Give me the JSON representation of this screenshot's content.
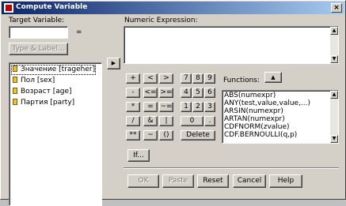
{
  "window": {
    "title": "Compute Variable",
    "close_glyph": "×"
  },
  "target": {
    "label": "Target Variable:",
    "value": "",
    "equals": "="
  },
  "type_label_button": "Type & Label...",
  "numeric_expression": {
    "label": "Numeric Expression:",
    "value": ""
  },
  "variables": [
    {
      "label": "Значение [trageher]",
      "selected": true
    },
    {
      "label": "Пол [sex]"
    },
    {
      "label": "Возраст [age]"
    },
    {
      "label": "Партия [party]"
    }
  ],
  "move_arrow": "▶",
  "keypad": [
    [
      "+",
      "<",
      ">",
      "7",
      "8",
      "9"
    ],
    [
      "-",
      "<=",
      ">=",
      "4",
      "5",
      "6"
    ],
    [
      "*",
      "=",
      "~=",
      "1",
      "2",
      "3"
    ],
    [
      "/",
      "&",
      "|",
      "0",
      "."
    ],
    [
      "**",
      "~",
      "()",
      "Delete"
    ]
  ],
  "functions": {
    "label": "Functions:",
    "up_arrow": "▲",
    "items": [
      "ABS(numexpr)",
      "ANY(test,value,value,...)",
      "ARSIN(numexpr)",
      "ARTAN(numexpr)",
      "CDFNORM(zvalue)",
      "CDF.BERNOULLI(q,p)"
    ]
  },
  "if_button": "If...",
  "buttons": {
    "ok": "OK",
    "paste": "Paste",
    "reset": "Reset",
    "cancel": "Cancel",
    "help": "Help"
  },
  "scroll": {
    "up": "▲",
    "down": "▼"
  }
}
